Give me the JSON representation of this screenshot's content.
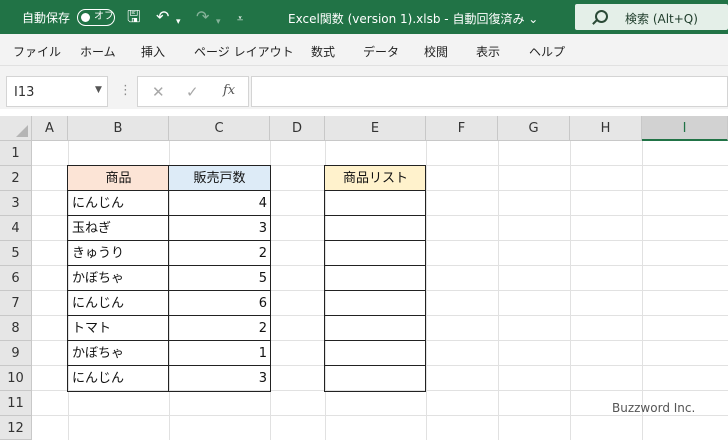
{
  "titlebar": {
    "autosave_label": "自動保存",
    "autosave_state": "オフ",
    "document_title": "Excel関数 (version 1).xlsb - 自動回復済み ⌄",
    "search_placeholder": "検索 (Alt+Q)",
    "background_color": "#217346"
  },
  "ribbon": {
    "tabs": [
      "ファイル",
      "ホーム",
      "挿入",
      "ページ レイアウト",
      "数式",
      "データ",
      "校閲",
      "表示",
      "ヘルプ"
    ]
  },
  "formula_bar": {
    "name_box": "I13",
    "fx_label": "fx",
    "formula": ""
  },
  "sheet": {
    "columns": [
      "A",
      "B",
      "C",
      "D",
      "E",
      "F",
      "G",
      "H",
      "I"
    ],
    "selected_column": "I",
    "rows": [
      "1",
      "2",
      "3",
      "4",
      "5",
      "6",
      "7",
      "8",
      "9",
      "10",
      "11",
      "12"
    ],
    "table1": {
      "header_product": "商品",
      "header_sales": "販売戸数",
      "header_product_bg": "#fce4d6",
      "header_sales_bg": "#ddebf7",
      "products": [
        "にんじん",
        "玉ねぎ",
        "きゅうり",
        "かぼちゃ",
        "にんじん",
        "トマト",
        "かぼちゃ",
        "にんじん"
      ],
      "sales": [
        "4",
        "3",
        "2",
        "5",
        "6",
        "2",
        "1",
        "3"
      ]
    },
    "table2": {
      "header": "商品リスト",
      "header_bg": "#fff2cc"
    }
  },
  "watermark": "Buzzword Inc."
}
